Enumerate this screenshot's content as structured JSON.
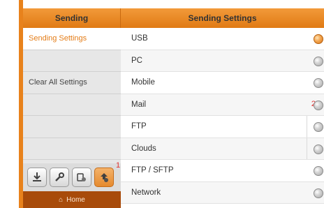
{
  "header": {
    "left_title": "Sending",
    "right_title": "Sending Settings"
  },
  "sidebar": {
    "items": [
      {
        "label": "Sending Settings",
        "active": true
      },
      {
        "label": ""
      },
      {
        "label": "Clear All Settings"
      },
      {
        "label": ""
      },
      {
        "label": ""
      },
      {
        "label": ""
      }
    ],
    "toolbar": {
      "buttons": [
        {
          "icon": "download-icon"
        },
        {
          "icon": "wrench-icon"
        },
        {
          "icon": "device-settings-icon"
        },
        {
          "icon": "upload-settings-icon",
          "selected": true
        }
      ],
      "callout": "1"
    },
    "home": {
      "label": "Home",
      "icon": "home-icon"
    }
  },
  "settings": {
    "rows": [
      {
        "label": "USB",
        "selected": true
      },
      {
        "label": "PC"
      },
      {
        "label": "Mobile"
      },
      {
        "label": "Mail",
        "callout": "2"
      },
      {
        "label": "FTP"
      },
      {
        "label": "Clouds"
      },
      {
        "label": "FTP / SFTP"
      },
      {
        "label": "Network"
      }
    ]
  },
  "colors": {
    "accent": "#e8821c",
    "home_bar": "#a84b0a",
    "callout": "#e03030"
  }
}
